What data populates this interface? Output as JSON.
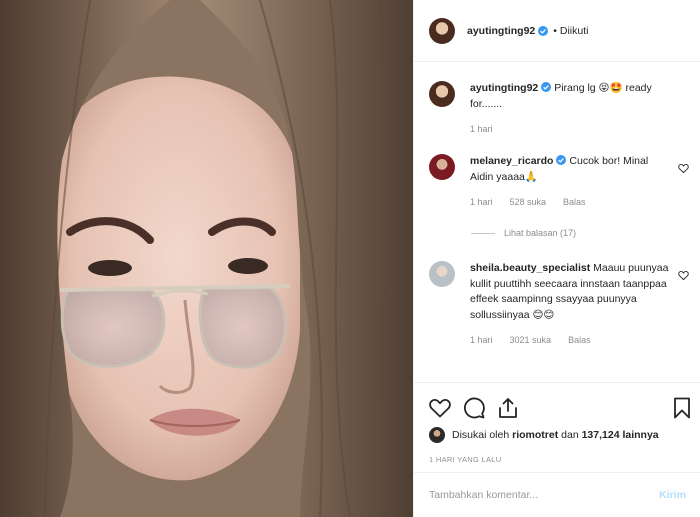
{
  "post": {
    "author": "ayutingting92",
    "follow_status": "• Diikuti",
    "caption": {
      "username": "ayutingting92",
      "text": "Pirang lg 😝🤩 ready for.......",
      "time": "1 hari"
    },
    "comments": [
      {
        "username": "melaney_ricardo",
        "text": "Cucok bor! Minal Aidin yaaaa🙏",
        "time": "1 hari",
        "likes": "528 suka",
        "reply": "Balas"
      },
      {
        "username": "sheila.beauty_specialist",
        "text": "Maauu puunyaa kullit puuttihh seecaara innstaan taanppaa effeek saampinng ssayyaa puunyya sollussiinyaa 😊😊",
        "time": "1 hari",
        "likes": "3021 suka",
        "reply": "Balas"
      }
    ],
    "view_replies": "Lihat balasan (17)",
    "likes_line": {
      "prefix": "Disukai oleh ",
      "user": "riomotret",
      "middle": " dan ",
      "count": "137,124 lainnya"
    },
    "posted_time": "1 HARI YANG LALU",
    "composer": {
      "placeholder": "Tambahkan komentar...",
      "submit": "Kirim"
    }
  },
  "icons": {
    "like": "heart-icon",
    "comment": "comment-icon",
    "share": "share-icon",
    "save": "bookmark-icon",
    "verified": "verified-badge-icon"
  },
  "colors": {
    "verified": "#3897f0",
    "muted": "#8e8e8e",
    "submit_disabled": "#b2dffc"
  }
}
